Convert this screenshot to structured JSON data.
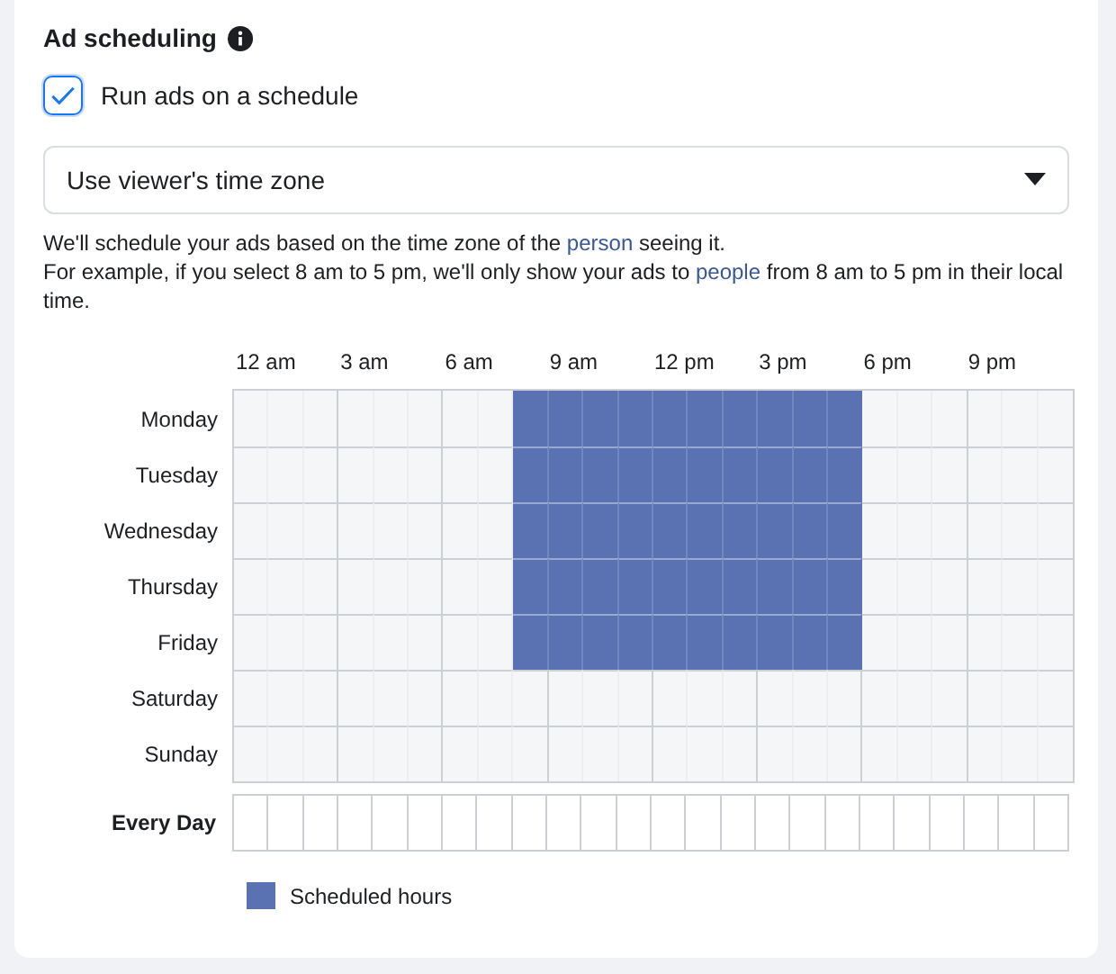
{
  "section": {
    "title": "Ad scheduling"
  },
  "schedule_toggle": {
    "label": "Run ads on a schedule",
    "checked": true
  },
  "time_zone_dropdown": {
    "value": "Use viewer's time zone"
  },
  "description": [
    [
      {
        "kind": "text",
        "text": "We'll schedule your ads based on the time zone of the"
      },
      {
        "kind": "link",
        "text": "person"
      },
      {
        "kind": "text",
        "text": "seeing it."
      }
    ],
    [
      {
        "kind": "text",
        "text": "For example, if you select 8 am to 5 pm, we'll only show your ads to"
      },
      {
        "kind": "link",
        "text": "people"
      },
      {
        "kind": "text",
        "text": "from 8 am to 5 pm in their local time."
      }
    ]
  ],
  "time_labels": [
    "12 am",
    "3 am",
    "6 am",
    "9 am",
    "12 pm",
    "3 pm",
    "6 pm",
    "9 pm"
  ],
  "days": [
    {
      "label": "Monday",
      "hours": [
        false,
        false,
        false,
        false,
        false,
        false,
        false,
        false,
        true,
        true,
        true,
        true,
        true,
        true,
        true,
        true,
        true,
        true,
        false,
        false,
        false,
        false,
        false,
        false
      ]
    },
    {
      "label": "Tuesday",
      "hours": [
        false,
        false,
        false,
        false,
        false,
        false,
        false,
        false,
        true,
        true,
        true,
        true,
        true,
        true,
        true,
        true,
        true,
        true,
        false,
        false,
        false,
        false,
        false,
        false
      ]
    },
    {
      "label": "Wednesday",
      "hours": [
        false,
        false,
        false,
        false,
        false,
        false,
        false,
        false,
        true,
        true,
        true,
        true,
        true,
        true,
        true,
        true,
        true,
        true,
        false,
        false,
        false,
        false,
        false,
        false
      ]
    },
    {
      "label": "Thursday",
      "hours": [
        false,
        false,
        false,
        false,
        false,
        false,
        false,
        false,
        true,
        true,
        true,
        true,
        true,
        true,
        true,
        true,
        true,
        true,
        false,
        false,
        false,
        false,
        false,
        false
      ]
    },
    {
      "label": "Friday",
      "hours": [
        false,
        false,
        false,
        false,
        false,
        false,
        false,
        false,
        true,
        true,
        true,
        true,
        true,
        true,
        true,
        true,
        true,
        true,
        false,
        false,
        false,
        false,
        false,
        false
      ]
    },
    {
      "label": "Saturday",
      "hours": [
        false,
        false,
        false,
        false,
        false,
        false,
        false,
        false,
        false,
        false,
        false,
        false,
        false,
        false,
        false,
        false,
        false,
        false,
        false,
        false,
        false,
        false,
        false,
        false
      ]
    },
    {
      "label": "Sunday",
      "hours": [
        false,
        false,
        false,
        false,
        false,
        false,
        false,
        false,
        false,
        false,
        false,
        false,
        false,
        false,
        false,
        false,
        false,
        false,
        false,
        false,
        false,
        false,
        false,
        false
      ]
    }
  ],
  "every_day": {
    "label": "Every Day"
  },
  "legend": {
    "label": "Scheduled hours"
  }
}
